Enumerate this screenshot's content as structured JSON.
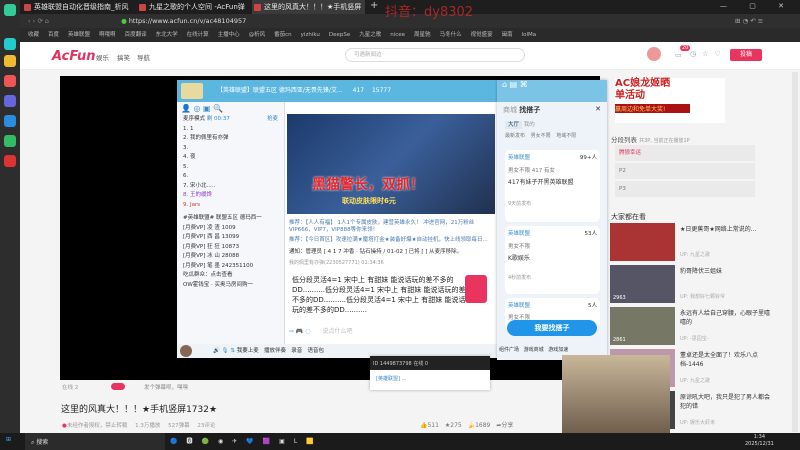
{
  "browser": {
    "tabs": [
      "英雄联盟自动化晋级指南_析风",
      "九星之歌的个人空间 -AcFun弹",
      "这里的风真大！！！★手机竖屏"
    ],
    "url": "https://www.acfun.cn/v/ac48104957",
    "bookmarks": [
      "收藏",
      "百度",
      "英雄联盟",
      "啊哦啊",
      "百度翻译",
      "东北大学",
      "在线计算",
      "主播中心",
      "@析风",
      "番茄cn",
      "yizhiku",
      "DeepSe",
      "九星之歌",
      "nicee",
      "周星驰",
      "马冬什么",
      "视觉盛宴",
      "闽南",
      "lolMa"
    ]
  },
  "watermark": "抖音：dy8302",
  "acfun": {
    "logo": "AcFun",
    "nav": [
      "娱乐",
      "搞笑",
      "导航"
    ],
    "search_placeholder": "可遇新闻边",
    "notif_count": "20",
    "post": "投稿"
  },
  "yy": {
    "title": "【英雄联盟】联盟五区 德玛西亚/无畏先锋/艾...",
    "stats": [
      "417",
      "15777"
    ],
    "mic_mode": "麦序模式",
    "timer": "剩 00:37",
    "grab": "抢麦",
    "mic_list": [
      "1.  1",
      "2.  我的佩里有亦弹",
      "3.",
      "4.  夜",
      "5.",
      "6.",
      "7.  宋小北.....",
      "8.  王的缓馋",
      "9.  Jars"
    ],
    "channels": [
      "#英雄联盟# 联盟五区 德玛西一",
      "[月费VP] 凌 渣 1009",
      "[月费VP] 西 昌 13099",
      "[月费VP] 狂 狂 10873",
      "[月费VP] 冰 山 28088",
      "[月费VP] 笔 墨 242351100",
      "吃瓜群众：点击查看",
      "OW霍钱宝 · 买奥马房间购一"
    ],
    "banner": "黑猫警长，双抓！",
    "banner_sub": "联动皮肤限时6元",
    "notices": [
      "推荐：【人人有福】 1人1个专属皮肤，建营英雄永久！ 冲进官网，21万粉丝VIP666，VIP7，VIP888等你来领！",
      "推荐：【今日首区】攻速拉满★魔塔打金★装备好爆★自动挂机，快上线领取每日...",
      " 通知：管理员 [ 4 1 7 冲香 · 钻石操持 / 01-02 ] 已将 [ ] 从麦序移除。"
    ],
    "msg_author": "我的佩里有亦弹(2230527771) 01:34:36",
    "msg": "低分段灵活4=1 宋中上 有甜妹 能说话玩的差不多的DD..........低分段灵活4=1 宋中上 有甜妹 能说话玩的差不多的DD..........低分段灵活4=1 宋中上 有甜妹 能说话玩的差不多的DD..........",
    "input_placeholder": "说点什么吧",
    "bottom": [
      "我要上麦",
      "播放伴奏",
      "录音",
      "语音包"
    ]
  },
  "finder": {
    "tabs": [
      "商城",
      "找搭子"
    ],
    "sub": [
      "大厅",
      "我的"
    ],
    "filters": [
      "最新发布",
      "男女不限",
      "地域不限"
    ],
    "cards": [
      {
        "game": "英雄联盟",
        "count": "99+人",
        "tags": [
          "男女不限",
          "417",
          "有女"
        ],
        "text": "417有妹子开黑英雄联盟",
        "time": "9天前发布"
      },
      {
        "game": "英雄联盟",
        "count": "53人",
        "tags": [
          "男女不限"
        ],
        "text": "K歌娱乐",
        "time": "4秒前发布"
      },
      {
        "game": "英雄联盟",
        "count": "5人",
        "tags": [
          "男女不限"
        ]
      }
    ],
    "cta": "我要找搭子",
    "footer": [
      "组件广场",
      "游戏商城",
      "游戏加速"
    ]
  },
  "small_window": {
    "id": "ID 1449873798",
    "online": "在线 0",
    "name": "[英雄联盟] ..."
  },
  "right": {
    "ad_title": "AC娘龙姬晒单活动",
    "ad_sub": "赢周边和免单大奖!",
    "seg_title": "分段列表",
    "seg_info": "共3P, 当前正在播放1P",
    "segs": [
      "腾狼幸运",
      "P2",
      "P3"
    ],
    "watching": "大家都在看",
    "videos": [
      {
        "title": "★日更蕉哥★网络上常说的...",
        "up": "UP: 九星之歌",
        "views": ""
      },
      {
        "title": "豹哥降伏三姐妹",
        "up": "UP: 我想好七颗铃爷",
        "views": "2963",
        "danmu": "29"
      },
      {
        "title": "永远有人给自己穿腰，心眼子里嘻嘻的",
        "up": "UP: -思园宝-",
        "views": "2861",
        "danmu": "32"
      },
      {
        "title": "董卓还是太全面了！欢乐八点档-1446",
        "up": "UP: 九星之歌"
      },
      {
        "title": "原谅吼大吧，我只是犯了男人都会犯的错",
        "up": "UP: 娱乐大虾米"
      }
    ]
  },
  "player": {
    "online": "在线 2",
    "danmu_placeholder": "发个弹幕呗，嘿嘿"
  },
  "video": {
    "title": "这里的风真大！！！★手机竖屏1732★",
    "copyright": "未经作者授权，禁止转载",
    "plays": "1.3万播放",
    "danmu": "527弹幕",
    "comments": "23评论",
    "likes": "511",
    "stars": "275",
    "bananas": "1689",
    "share": "分享"
  },
  "taskbar": {
    "search": "搜索",
    "time": "1:34",
    "date": "2025/12/31"
  }
}
